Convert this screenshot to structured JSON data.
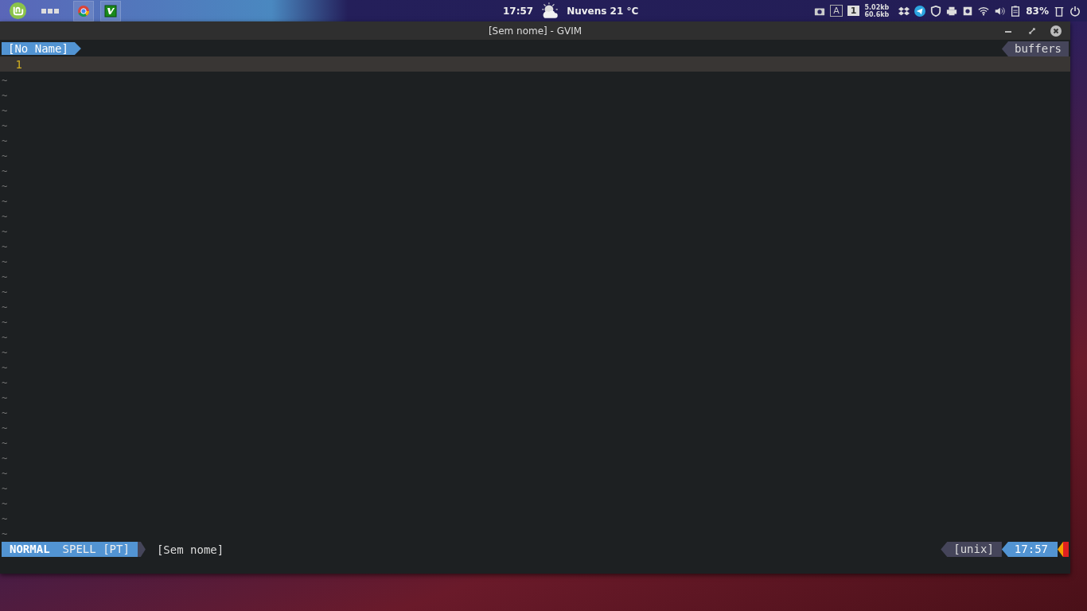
{
  "panel": {
    "clock": "17:57",
    "weather": "Nuvens 21 °C",
    "keyboard": "A",
    "workspace": "1",
    "net_down": "5.02kb",
    "net_up": "60.6kb",
    "battery": "83%"
  },
  "window": {
    "title": "[Sem nome] - GVIM"
  },
  "tabline": {
    "tabs": [
      {
        "label": "[No Name]",
        "selected": true
      }
    ],
    "right": "buffers"
  },
  "editor": {
    "lines": [
      {
        "number": "1"
      }
    ],
    "tildes": [
      "~",
      "~",
      "~",
      "~",
      "~",
      "~",
      "~",
      "~",
      "~",
      "~",
      "~",
      "~",
      "~",
      "~",
      "~",
      "~",
      "~",
      "~",
      "~",
      "~",
      "~",
      "~",
      "~",
      "~",
      "~",
      "~",
      "~",
      "~",
      "~",
      "~",
      "~"
    ]
  },
  "statusline": {
    "mode": "NORMAL",
    "spell": "SPELL [PT]",
    "file": "[Sem nome]",
    "format": "[unix]",
    "time": "17:57"
  }
}
